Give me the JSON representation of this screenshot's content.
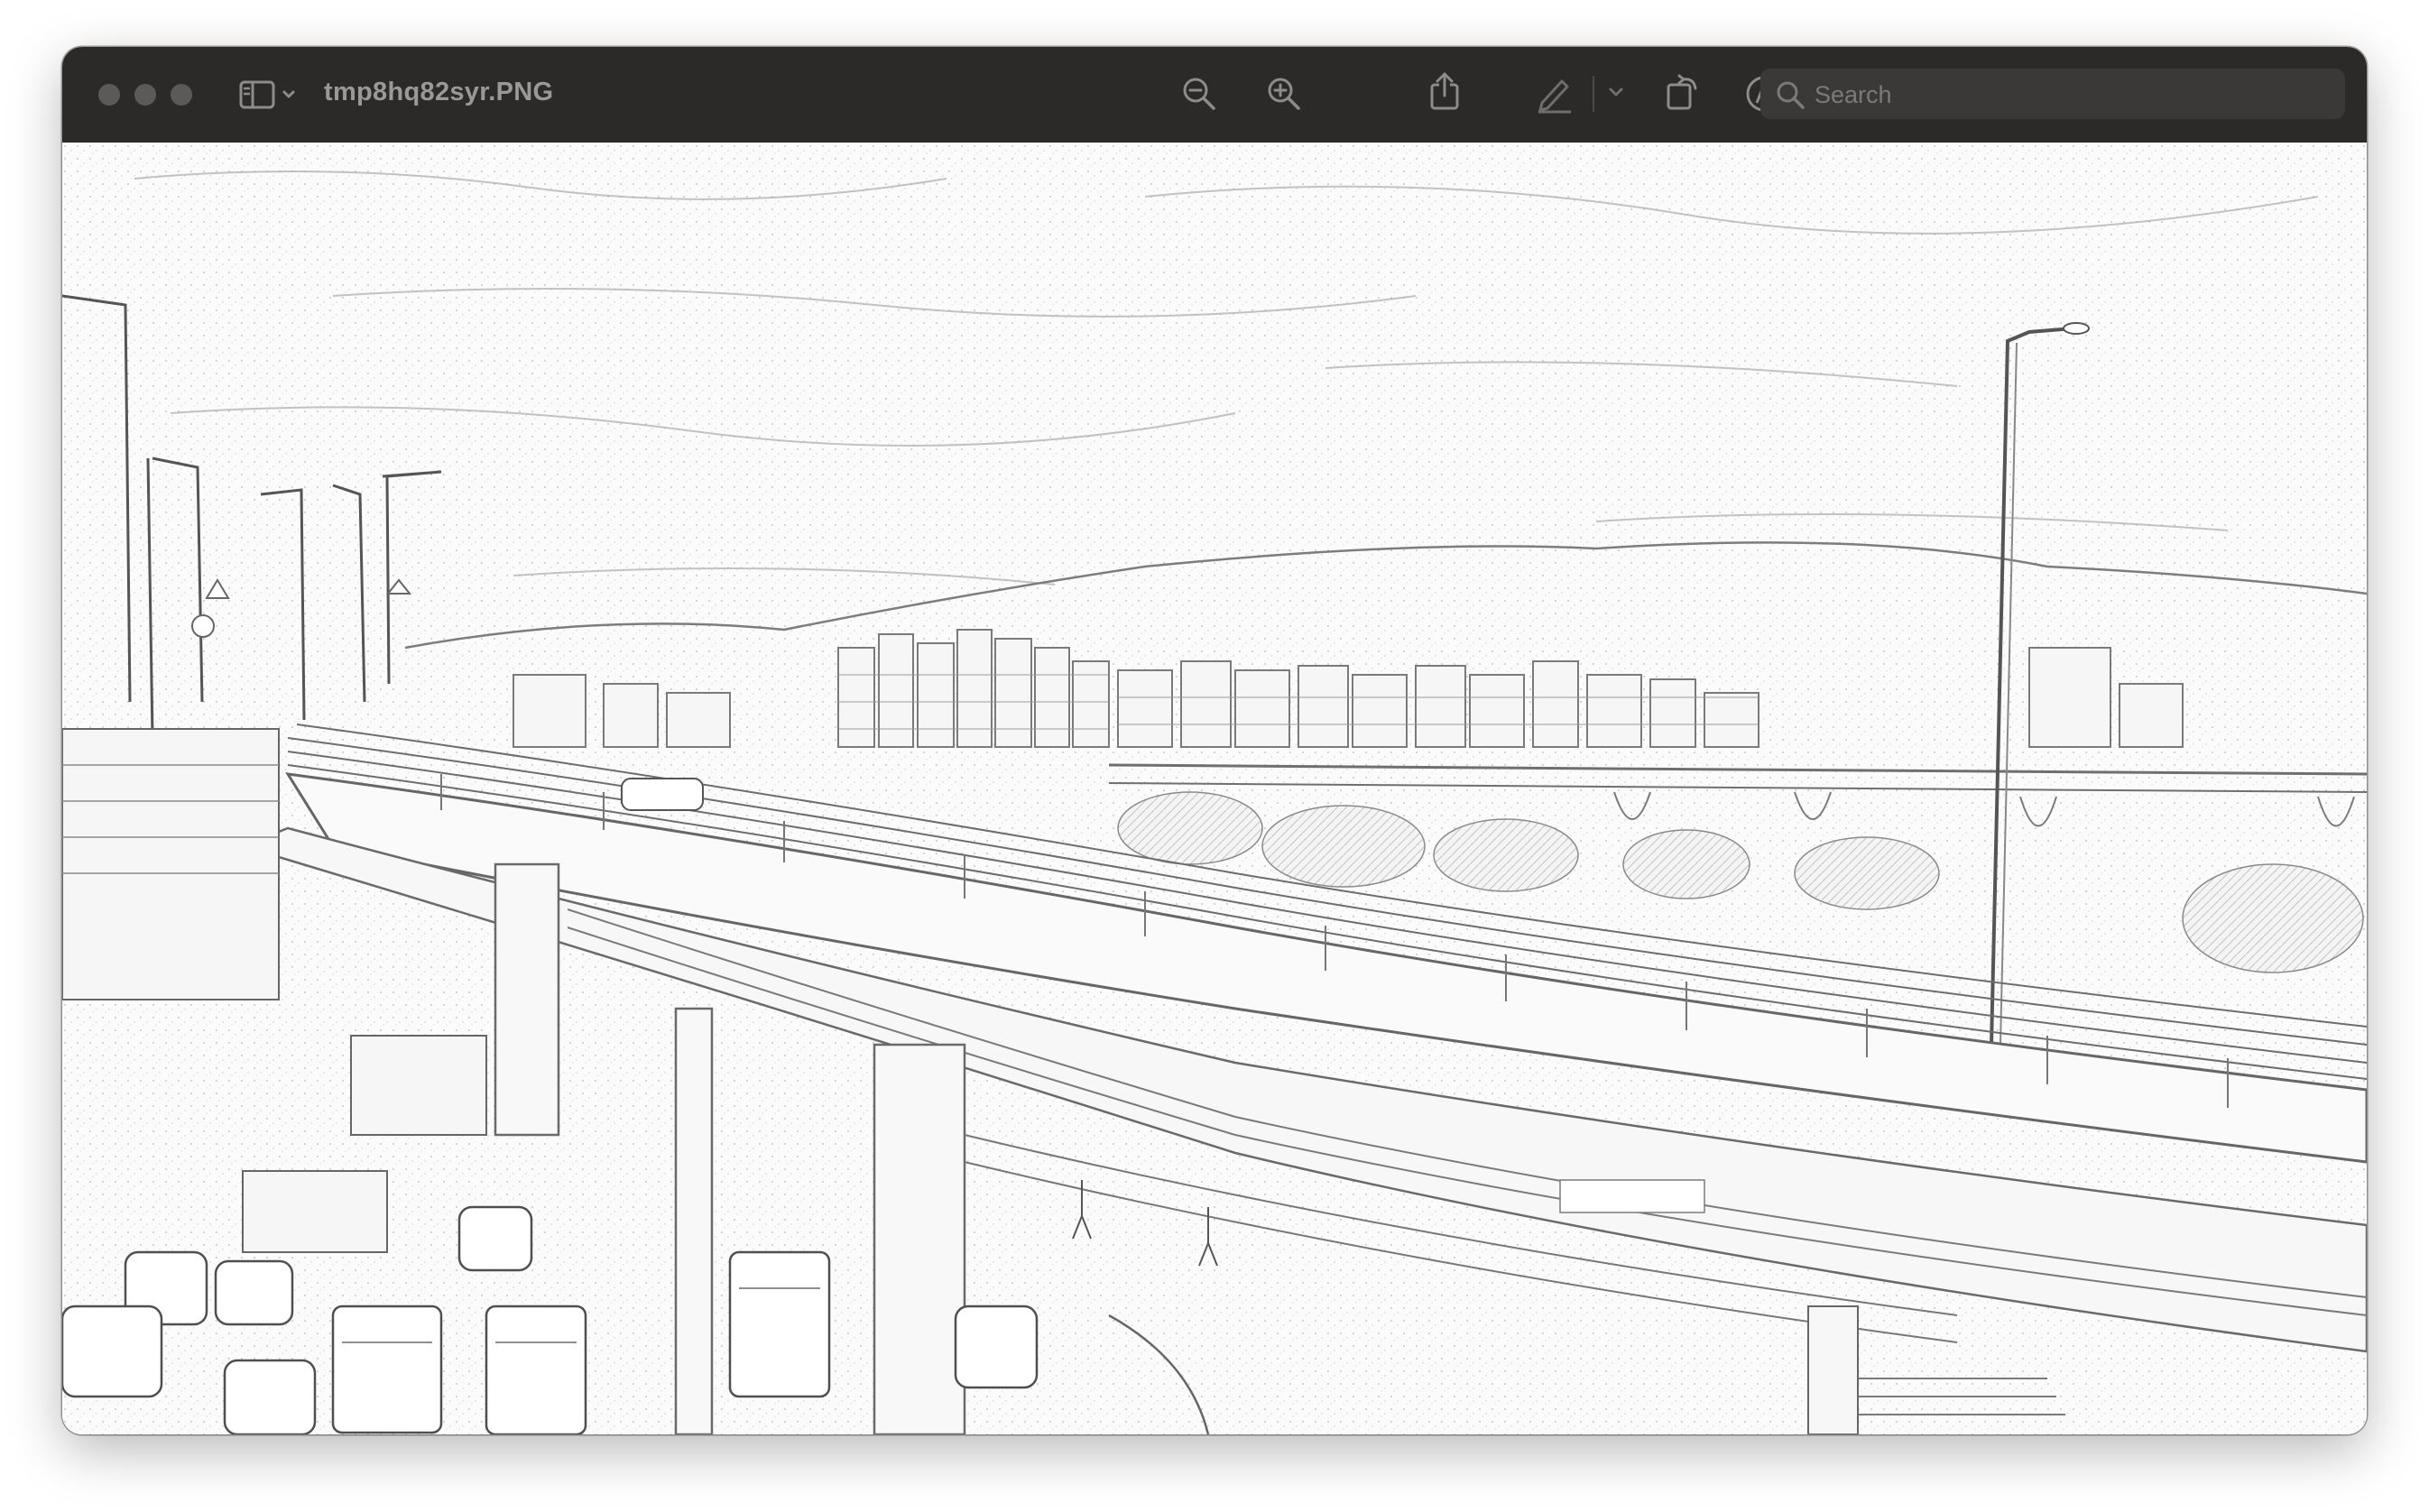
{
  "window": {
    "title": "tmp8hq82syr.PNG"
  },
  "toolbar": {
    "icons": [
      "sidebar-icon",
      "chevron-down-icon",
      "zoom-out-icon",
      "zoom-in-icon",
      "share-icon",
      "markup-pen-icon",
      "chevron-down-icon",
      "rotate-icon",
      "annotate-icon",
      "search-icon"
    ]
  },
  "search": {
    "placeholder": "Search"
  },
  "colors": {
    "toolbar_bg": "#2b2a29",
    "search_bg": "#3a3938",
    "icon_gray": "#8d8c8a",
    "light_gray": "#5b5a59"
  }
}
